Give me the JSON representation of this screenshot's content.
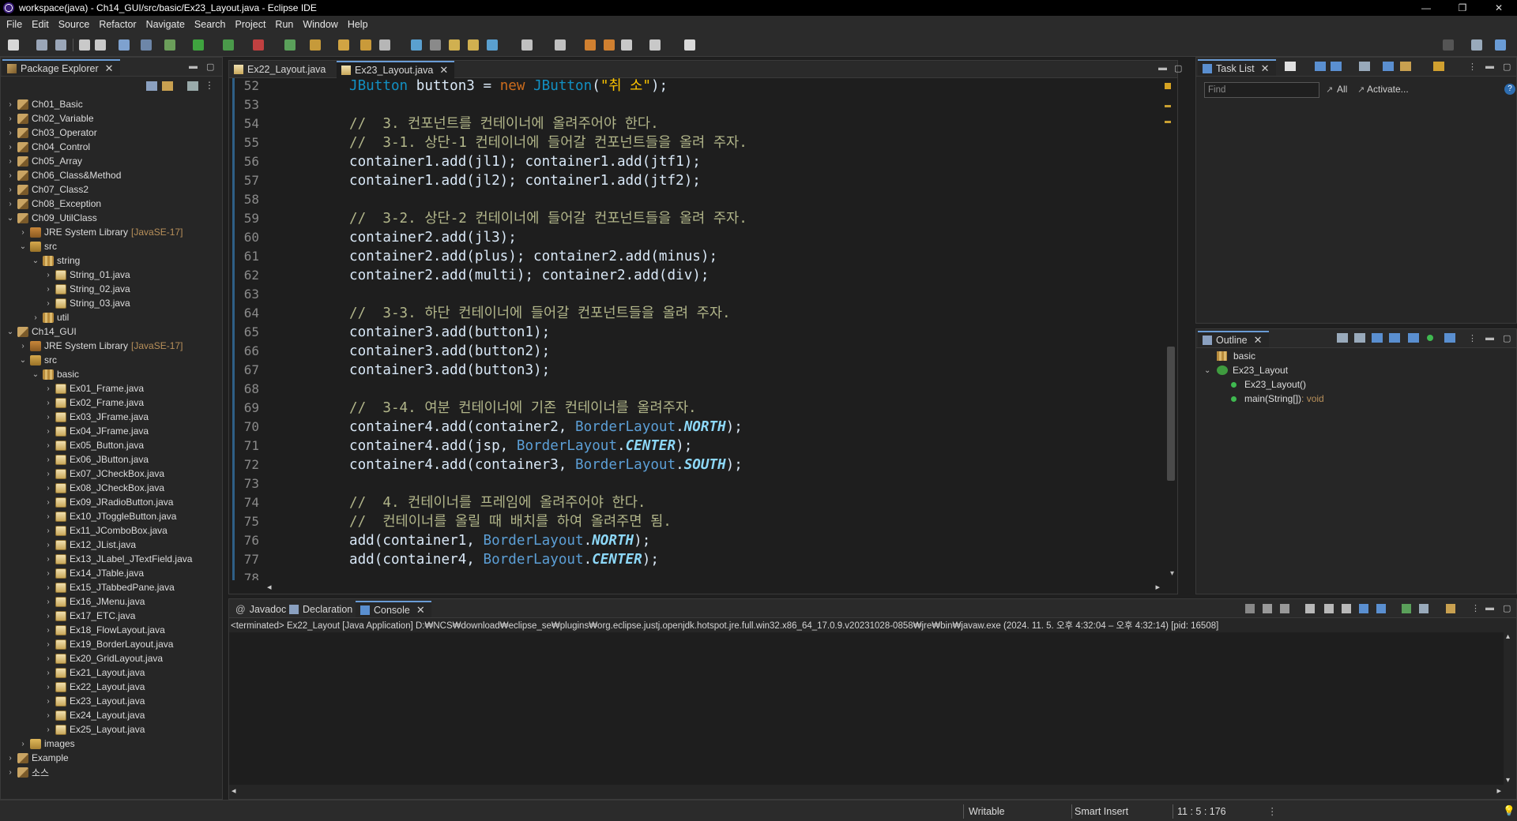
{
  "window": {
    "title": "workspace(java) - Ch14_GUI/src/basic/Ex23_Layout.java - Eclipse IDE",
    "controls": [
      "—",
      "❐",
      "✕"
    ]
  },
  "menu": [
    "File",
    "Edit",
    "Source",
    "Refactor",
    "Navigate",
    "Search",
    "Project",
    "Run",
    "Window",
    "Help"
  ],
  "package_explorer": {
    "tab_label": "Package Explorer",
    "items": [
      {
        "label": "Ch01_Basic",
        "icon": "project-icon",
        "depth": 0,
        "expanded": false
      },
      {
        "label": "Ch02_Variable",
        "icon": "project-icon",
        "depth": 0,
        "expanded": false
      },
      {
        "label": "Ch03_Operator",
        "icon": "project-icon",
        "depth": 0,
        "expanded": false
      },
      {
        "label": "Ch04_Control",
        "icon": "project-icon",
        "depth": 0,
        "expanded": false
      },
      {
        "label": "Ch05_Array",
        "icon": "project-icon",
        "depth": 0,
        "expanded": false
      },
      {
        "label": "Ch06_Class&Method",
        "icon": "project-icon",
        "depth": 0,
        "expanded": false
      },
      {
        "label": "Ch07_Class2",
        "icon": "project-icon",
        "depth": 0,
        "expanded": false
      },
      {
        "label": "Ch08_Exception",
        "icon": "project-icon",
        "depth": 0,
        "expanded": false
      },
      {
        "label": "Ch09_UtilClass",
        "icon": "project-icon",
        "depth": 0,
        "expanded": true
      },
      {
        "label": "JRE System Library",
        "deco": "[JavaSE-17]",
        "icon": "library-icon",
        "depth": 1,
        "expanded": false
      },
      {
        "label": "src",
        "icon": "source-folder-icon",
        "depth": 1,
        "expanded": true
      },
      {
        "label": "string",
        "icon": "package-icon",
        "depth": 2,
        "expanded": true
      },
      {
        "label": "String_01.java",
        "icon": "java-file-icon",
        "depth": 3,
        "expanded": false
      },
      {
        "label": "String_02.java",
        "icon": "java-file-icon",
        "depth": 3,
        "expanded": false
      },
      {
        "label": "String_03.java",
        "icon": "java-file-icon",
        "depth": 3,
        "expanded": false
      },
      {
        "label": "util",
        "icon": "package-icon",
        "depth": 2,
        "expanded": false
      },
      {
        "label": "Ch14_GUI",
        "icon": "project-icon",
        "depth": 0,
        "expanded": true
      },
      {
        "label": "JRE System Library",
        "deco": "[JavaSE-17]",
        "icon": "library-icon",
        "depth": 1,
        "expanded": false
      },
      {
        "label": "src",
        "icon": "source-folder-icon",
        "depth": 1,
        "expanded": true
      },
      {
        "label": "basic",
        "icon": "package-icon",
        "depth": 2,
        "expanded": true
      },
      {
        "label": "Ex01_Frame.java",
        "icon": "java-file-icon",
        "depth": 3,
        "expanded": false
      },
      {
        "label": "Ex02_Frame.java",
        "icon": "java-file-icon",
        "depth": 3,
        "expanded": false
      },
      {
        "label": "Ex03_JFrame.java",
        "icon": "java-file-icon",
        "depth": 3,
        "expanded": false
      },
      {
        "label": "Ex04_JFrame.java",
        "icon": "java-file-icon",
        "depth": 3,
        "expanded": false
      },
      {
        "label": "Ex05_Button.java",
        "icon": "java-file-icon",
        "depth": 3,
        "expanded": false
      },
      {
        "label": "Ex06_JButton.java",
        "icon": "java-file-icon",
        "depth": 3,
        "expanded": false
      },
      {
        "label": "Ex07_JCheckBox.java",
        "icon": "java-file-icon",
        "depth": 3,
        "expanded": false
      },
      {
        "label": "Ex08_JCheckBox.java",
        "icon": "java-file-icon",
        "depth": 3,
        "expanded": false
      },
      {
        "label": "Ex09_JRadioButton.java",
        "icon": "java-file-icon",
        "depth": 3,
        "expanded": false
      },
      {
        "label": "Ex10_JToggleButton.java",
        "icon": "java-file-icon",
        "depth": 3,
        "expanded": false
      },
      {
        "label": "Ex11_JComboBox.java",
        "icon": "java-file-icon",
        "depth": 3,
        "expanded": false
      },
      {
        "label": "Ex12_JList.java",
        "icon": "java-file-icon",
        "depth": 3,
        "expanded": false
      },
      {
        "label": "Ex13_JLabel_JTextField.java",
        "icon": "java-file-icon",
        "depth": 3,
        "expanded": false
      },
      {
        "label": "Ex14_JTable.java",
        "icon": "java-file-icon",
        "depth": 3,
        "expanded": false
      },
      {
        "label": "Ex15_JTabbedPane.java",
        "icon": "java-file-icon",
        "depth": 3,
        "expanded": false
      },
      {
        "label": "Ex16_JMenu.java",
        "icon": "java-file-icon",
        "depth": 3,
        "expanded": false
      },
      {
        "label": "Ex17_ETC.java",
        "icon": "java-file-icon",
        "depth": 3,
        "expanded": false
      },
      {
        "label": "Ex18_FlowLayout.java",
        "icon": "java-file-icon",
        "depth": 3,
        "expanded": false
      },
      {
        "label": "Ex19_BorderLayout.java",
        "icon": "java-file-icon",
        "depth": 3,
        "expanded": false
      },
      {
        "label": "Ex20_GridLayout.java",
        "icon": "java-file-icon",
        "depth": 3,
        "expanded": false
      },
      {
        "label": "Ex21_Layout.java",
        "icon": "java-file-icon",
        "depth": 3,
        "expanded": false
      },
      {
        "label": "Ex22_Layout.java",
        "icon": "java-file-icon",
        "depth": 3,
        "expanded": false
      },
      {
        "label": "Ex23_Layout.java",
        "icon": "java-file-icon",
        "depth": 3,
        "expanded": false
      },
      {
        "label": "Ex24_Layout.java",
        "icon": "java-file-icon",
        "depth": 3,
        "expanded": false
      },
      {
        "label": "Ex25_Layout.java",
        "icon": "java-file-icon",
        "depth": 3,
        "expanded": false
      },
      {
        "label": "images",
        "icon": "folder-icon",
        "depth": 1,
        "expanded": false
      },
      {
        "label": "Example",
        "icon": "project-icon",
        "depth": 0,
        "expanded": false
      },
      {
        "label": "소스",
        "icon": "project-icon",
        "depth": 0,
        "expanded": false
      }
    ]
  },
  "editor": {
    "tabs": [
      {
        "label": "Ex22_Layout.java",
        "active": false
      },
      {
        "label": "Ex23_Layout.java",
        "active": true
      }
    ],
    "lines": [
      {
        "n": "52",
        "tokens": [
          [
            "cls",
            "JButton"
          ],
          [
            "p",
            " button3 = "
          ],
          [
            "kw",
            "new"
          ],
          [
            "p",
            " "
          ],
          [
            "cls",
            "JButton"
          ],
          [
            "p",
            "("
          ],
          [
            "str",
            "\"취 소\""
          ],
          [
            "p",
            ");"
          ]
        ]
      },
      {
        "n": "53",
        "tokens": []
      },
      {
        "n": "54",
        "tokens": [
          [
            "cmt",
            "//  3. 컨포넌트를 컨테이너에 올려주어야 한다."
          ]
        ]
      },
      {
        "n": "55",
        "tokens": [
          [
            "cmt",
            "//  3-1. 상단-1 컨테이너에 들어갈 컨포넌트들을 올려 주자."
          ]
        ]
      },
      {
        "n": "56",
        "tokens": [
          [
            "p",
            "container1.add(jl1); container1.add(jtf1);"
          ]
        ]
      },
      {
        "n": "57",
        "tokens": [
          [
            "p",
            "container1.add(jl2); container1.add(jtf2);"
          ]
        ]
      },
      {
        "n": "58",
        "tokens": []
      },
      {
        "n": "59",
        "tokens": [
          [
            "cmt",
            "//  3-2. 상단-2 컨테이너에 들어갈 컨포넌트들을 올려 주자."
          ]
        ]
      },
      {
        "n": "60",
        "tokens": [
          [
            "p",
            "container2.add(jl3);"
          ]
        ]
      },
      {
        "n": "61",
        "tokens": [
          [
            "p",
            "container2.add(plus); container2.add(minus);"
          ]
        ]
      },
      {
        "n": "62",
        "tokens": [
          [
            "p",
            "container2.add(multi); container2.add(div);"
          ]
        ]
      },
      {
        "n": "63",
        "tokens": []
      },
      {
        "n": "64",
        "tokens": [
          [
            "cmt",
            "//  3-3. 하단 컨테이너에 들어갈 컨포넌트들을 올려 주자."
          ]
        ]
      },
      {
        "n": "65",
        "tokens": [
          [
            "p",
            "container3.add(button1);"
          ]
        ]
      },
      {
        "n": "66",
        "tokens": [
          [
            "p",
            "container3.add(button2);"
          ]
        ]
      },
      {
        "n": "67",
        "tokens": [
          [
            "p",
            "container3.add(button3);"
          ]
        ]
      },
      {
        "n": "68",
        "tokens": []
      },
      {
        "n": "69",
        "tokens": [
          [
            "cmt",
            "//  3-4. 여분 컨테이너에 기존 컨테이너를 올려주자."
          ]
        ]
      },
      {
        "n": "70",
        "tokens": [
          [
            "p",
            "container4.add(container2, "
          ],
          [
            "cls2",
            "BorderLayout"
          ],
          [
            "p",
            "."
          ],
          [
            "sf",
            "NORTH"
          ],
          [
            "p",
            ");"
          ]
        ]
      },
      {
        "n": "71",
        "tokens": [
          [
            "p",
            "container4.add(jsp, "
          ],
          [
            "cls2",
            "BorderLayout"
          ],
          [
            "p",
            "."
          ],
          [
            "sf",
            "CENTER"
          ],
          [
            "p",
            ");"
          ]
        ]
      },
      {
        "n": "72",
        "tokens": [
          [
            "p",
            "container4.add(container3, "
          ],
          [
            "cls2",
            "BorderLayout"
          ],
          [
            "p",
            "."
          ],
          [
            "sf",
            "SOUTH"
          ],
          [
            "p",
            ");"
          ]
        ]
      },
      {
        "n": "73",
        "tokens": []
      },
      {
        "n": "74",
        "tokens": [
          [
            "cmt",
            "//  4. 컨테이너를 프레임에 올려주어야 한다."
          ]
        ]
      },
      {
        "n": "75",
        "tokens": [
          [
            "cmt",
            "//  컨테이너를 올릴 때 배치를 하여 올려주면 됨."
          ]
        ]
      },
      {
        "n": "76",
        "tokens": [
          [
            "p",
            "add(container1, "
          ],
          [
            "cls2",
            "BorderLayout"
          ],
          [
            "p",
            "."
          ],
          [
            "sf",
            "NORTH"
          ],
          [
            "p",
            ");"
          ]
        ]
      },
      {
        "n": "77",
        "tokens": [
          [
            "p",
            "add(container4, "
          ],
          [
            "cls2",
            "BorderLayout"
          ],
          [
            "p",
            "."
          ],
          [
            "sf",
            "CENTER"
          ],
          [
            "p",
            ");"
          ]
        ]
      },
      {
        "n": "78",
        "tokens": []
      }
    ]
  },
  "task_list": {
    "tab_label": "Task List",
    "find_placeholder": "Find",
    "all_label": "All",
    "activate_label": "Activate..."
  },
  "outline": {
    "tab_label": "Outline",
    "package": "basic",
    "class": "Ex23_Layout",
    "members": [
      {
        "label": "Ex23_Layout()",
        "ret": ""
      },
      {
        "label": "main(String[])",
        "ret": " : void"
      }
    ]
  },
  "console": {
    "tabs": [
      "Javadoc",
      "Declaration",
      "Console"
    ],
    "active_tab": "Console",
    "terminated_line": "<terminated> Ex22_Layout [Java Application] D:₩NCS₩download₩eclipse_se₩plugins₩org.eclipse.justj.openjdk.hotspot.jre.full.win32.x86_64_17.0.9.v20231028-0858₩jre₩bin₩javaw.exe  (2024. 11. 5. 오후 4:32:04 – 오후 4:32:14) [pid: 16508]"
  },
  "status": {
    "mode": "Writable",
    "insert": "Smart Insert",
    "position": "11 : 5 : 176"
  },
  "colors": {
    "keyword": "#cc6c1d",
    "class": "#1290c3",
    "comment": "#b2b68a",
    "string": "#ffc600",
    "static_field": "#8dd8f8",
    "accent": "#6a9cd6"
  }
}
